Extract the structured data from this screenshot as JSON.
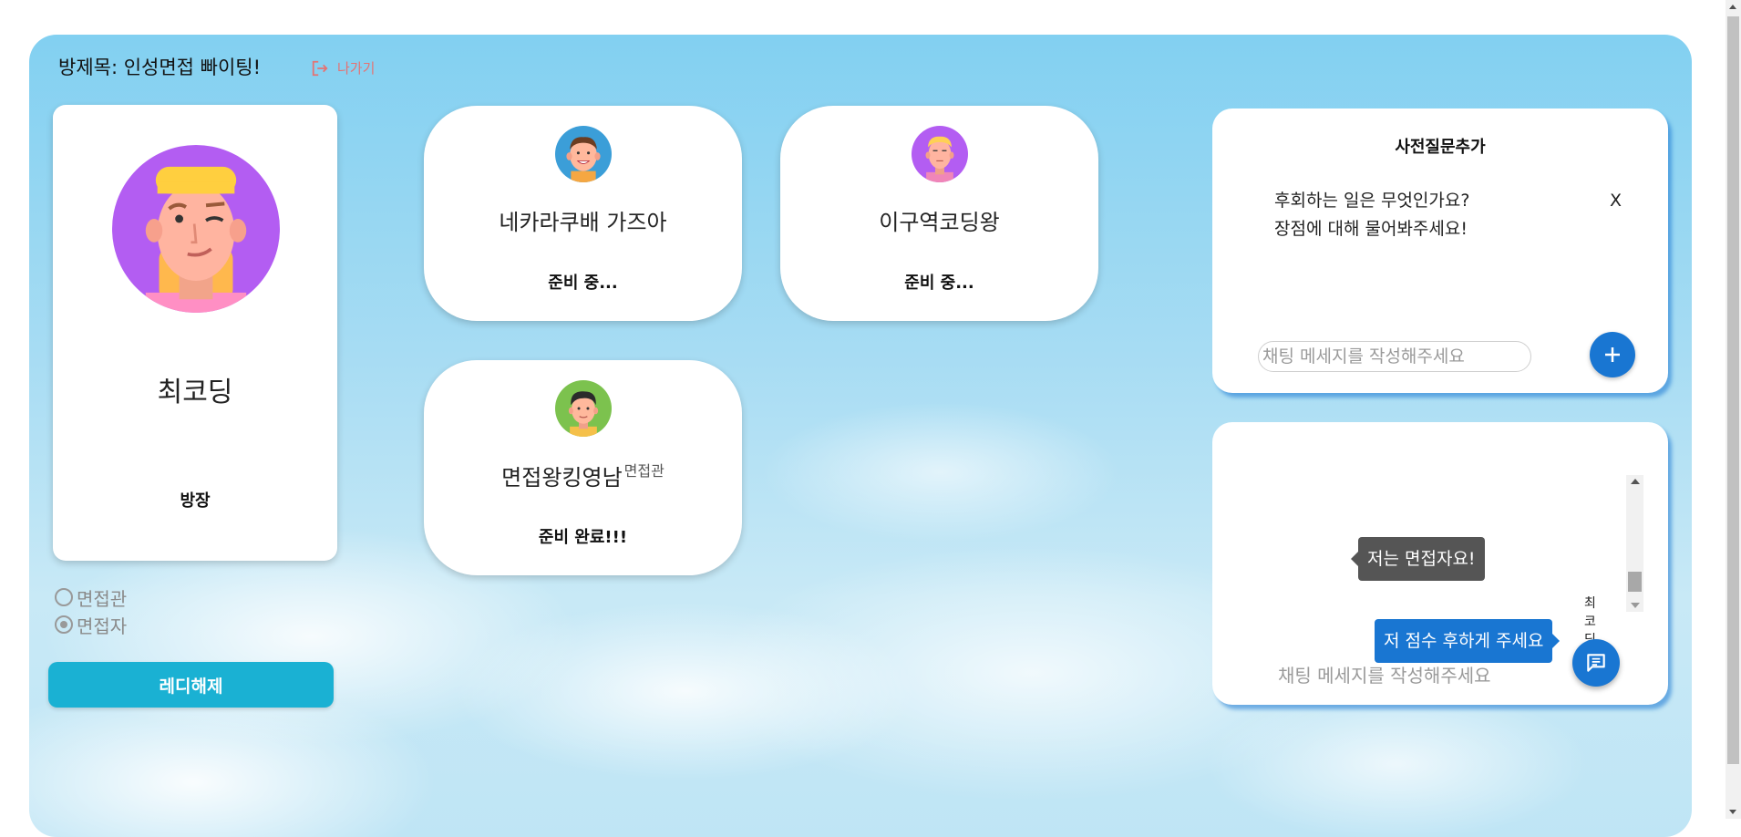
{
  "header": {
    "room_title": "방제목: 인성면접 빠이팅!",
    "exit_label": "나가기"
  },
  "me": {
    "name": "최코딩",
    "role": "방장",
    "avatar_icon": "avatar-blonde-woman-icon"
  },
  "participants": [
    {
      "name": "네카라쿠배 가즈아",
      "badge": "",
      "status": "준비 중...",
      "avatar_icon": "avatar-boy-icon"
    },
    {
      "name": "이구역코딩왕",
      "badge": "",
      "status": "준비 중...",
      "avatar_icon": "avatar-blonde-man-icon"
    },
    {
      "name": "면접왕킹영남",
      "badge": "면접관",
      "status": "준비 완료!!!",
      "avatar_icon": "avatar-dark-hair-boy-icon"
    }
  ],
  "role_select": {
    "options": [
      "면접관",
      "면접자"
    ],
    "selected": "면접자"
  },
  "ready_button_label": "레디해제",
  "questions": {
    "title": "사전질문추가",
    "items": [
      "후회하는 일은 무엇인가요?",
      "장점에 대해 물어봐주세요!"
    ],
    "remove_label": "X",
    "input_placeholder": "채팅 메세지를 작성해주세요"
  },
  "chat": {
    "messages": [
      {
        "sender": "",
        "text": "저는 면접자요!",
        "mine": false
      },
      {
        "sender": "최코딩",
        "text": "저 점수 후하게 주세요",
        "mine": true
      }
    ],
    "input_placeholder": "채팅 메세지를 작성해주세요"
  },
  "colors": {
    "accent_blue": "#1976d2",
    "ready_button": "#1ab1d3",
    "exit_red": "#e57373"
  }
}
